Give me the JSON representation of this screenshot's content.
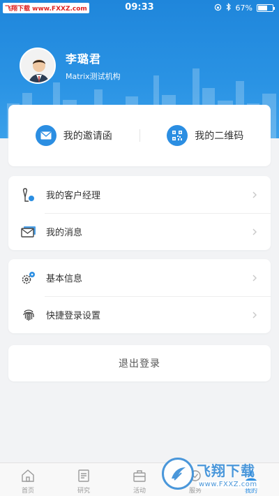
{
  "status_bar": {
    "watermark": "飞翔下载 www.FXXZ.com",
    "time": "09:33",
    "battery": "67%",
    "battery_level": 0.67
  },
  "profile": {
    "name": "李璐君",
    "org": "Matrix测试机构"
  },
  "invite_card": {
    "invitation_label": "我的邀请函",
    "qrcode_label": "我的二维码"
  },
  "menu_group_1": [
    {
      "label": "我的客户经理",
      "icon": "account-manager-icon"
    },
    {
      "label": "我的消息",
      "icon": "messages-icon"
    }
  ],
  "menu_group_2": [
    {
      "label": "基本信息",
      "icon": "settings-gear-icon"
    },
    {
      "label": "快捷登录设置",
      "icon": "fingerprint-icon"
    }
  ],
  "logout_label": "退出登录",
  "tabbar": [
    {
      "label": "首页",
      "icon": "home-icon",
      "active": false
    },
    {
      "label": "研究",
      "icon": "research-icon",
      "active": false
    },
    {
      "label": "活动",
      "icon": "activity-icon",
      "active": false
    },
    {
      "label": "服务",
      "icon": "service-icon",
      "active": false
    },
    {
      "label": "我的",
      "icon": "profile-icon",
      "active": true
    }
  ],
  "watermark": {
    "title": "飞翔下载",
    "url": "www.FXXZ.com"
  },
  "colors": {
    "primary": "#2b8ee2",
    "header_top": "#1f86db",
    "background": "#f2f3f5"
  }
}
